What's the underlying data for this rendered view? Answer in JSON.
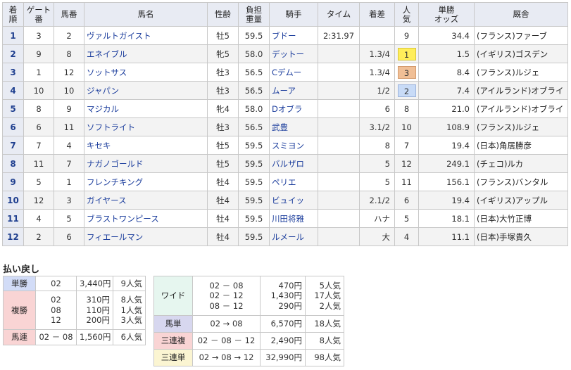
{
  "headers": {
    "rank": [
      "着",
      "順"
    ],
    "gate": [
      "ゲート",
      "番"
    ],
    "number": "馬番",
    "horse": "馬名",
    "sexage": "性齢",
    "weight": [
      "負担",
      "重量"
    ],
    "jockey": "騎手",
    "time": "タイム",
    "margin": "着差",
    "popularity": [
      "人",
      "気"
    ],
    "odds": [
      "単勝",
      "オッズ"
    ],
    "trainer": "厩舎"
  },
  "rows": [
    {
      "rank": "1",
      "gate": "3",
      "number": "2",
      "horse": "ヴァルトガイスト",
      "sexage": "牡5",
      "weight": "59.5",
      "jockey": "ブドー",
      "time": "2:31.97",
      "margin": "",
      "popularity": "9",
      "odds": "34.4",
      "trainer": "(フランス)ファーブ"
    },
    {
      "rank": "2",
      "gate": "9",
      "number": "8",
      "horse": "エネイブル",
      "sexage": "牝5",
      "weight": "58.0",
      "jockey": "デットー",
      "time": "",
      "margin": "1.3/4",
      "popularity": "1",
      "odds": "1.5",
      "trainer": "(イギリス)ゴスデン"
    },
    {
      "rank": "3",
      "gate": "1",
      "number": "12",
      "horse": "ソットサス",
      "sexage": "牡3",
      "weight": "56.5",
      "jockey": "Cデムー",
      "time": "",
      "margin": "1.3/4",
      "popularity": "3",
      "odds": "8.4",
      "trainer": "(フランス)ルジェ"
    },
    {
      "rank": "4",
      "gate": "10",
      "number": "10",
      "horse": "ジャパン",
      "sexage": "牡3",
      "weight": "56.5",
      "jockey": "ムーア",
      "time": "",
      "margin": "1/2",
      "popularity": "2",
      "odds": "7.4",
      "trainer": "(アイルランド)オブライ"
    },
    {
      "rank": "5",
      "gate": "8",
      "number": "9",
      "horse": "マジカル",
      "sexage": "牝4",
      "weight": "58.0",
      "jockey": "Dオブラ",
      "time": "",
      "margin": "6",
      "popularity": "8",
      "odds": "21.0",
      "trainer": "(アイルランド)オブライ"
    },
    {
      "rank": "6",
      "gate": "6",
      "number": "11",
      "horse": "ソフトライト",
      "sexage": "牡3",
      "weight": "56.5",
      "jockey": "武豊",
      "time": "",
      "margin": "3.1/2",
      "popularity": "10",
      "odds": "108.9",
      "trainer": "(フランス)ルジェ"
    },
    {
      "rank": "7",
      "gate": "7",
      "number": "4",
      "horse": "キセキ",
      "sexage": "牡5",
      "weight": "59.5",
      "jockey": "スミヨン",
      "time": "",
      "margin": "8",
      "popularity": "7",
      "odds": "19.4",
      "trainer": "(日本)角居勝彦"
    },
    {
      "rank": "8",
      "gate": "11",
      "number": "7",
      "horse": "ナガノゴールド",
      "sexage": "牡5",
      "weight": "59.5",
      "jockey": "バルザロ",
      "time": "",
      "margin": "5",
      "popularity": "12",
      "odds": "249.1",
      "trainer": "(チェコ)ルカ"
    },
    {
      "rank": "9",
      "gate": "5",
      "number": "1",
      "horse": "フレンチキング",
      "sexage": "牡4",
      "weight": "59.5",
      "jockey": "ペリエ",
      "time": "",
      "margin": "5",
      "popularity": "11",
      "odds": "156.1",
      "trainer": "(フランス)バンタル"
    },
    {
      "rank": "10",
      "gate": "12",
      "number": "3",
      "horse": "ガイヤース",
      "sexage": "牡4",
      "weight": "59.5",
      "jockey": "ビュイッ",
      "time": "",
      "margin": "2.1/2",
      "popularity": "6",
      "odds": "19.4",
      "trainer": "(イギリス)アップル"
    },
    {
      "rank": "11",
      "gate": "4",
      "number": "5",
      "horse": "ブラストワンピース",
      "sexage": "牡4",
      "weight": "59.5",
      "jockey": "川田将雅",
      "time": "",
      "margin": "ハナ",
      "popularity": "5",
      "odds": "18.1",
      "trainer": "(日本)大竹正博"
    },
    {
      "rank": "12",
      "gate": "2",
      "number": "6",
      "horse": "フィエールマン",
      "sexage": "牡4",
      "weight": "59.5",
      "jockey": "ルメール",
      "time": "",
      "margin": "大",
      "popularity": "4",
      "odds": "11.1",
      "trainer": "(日本)手塚貴久"
    }
  ],
  "payout": {
    "title": "払い戻し",
    "tansho": {
      "label": "単勝",
      "combo": "02",
      "amount": "3,440円",
      "pop": "9人気"
    },
    "fukusho": {
      "label": "複勝",
      "items": [
        {
          "combo": "02",
          "amount": "310円",
          "pop": "8人気"
        },
        {
          "combo": "08",
          "amount": "110円",
          "pop": "1人気"
        },
        {
          "combo": "12",
          "amount": "200円",
          "pop": "3人気"
        }
      ]
    },
    "umaren": {
      "label": "馬連",
      "combo": "02 － 08",
      "amount": "1,560円",
      "pop": "6人気"
    },
    "wide": {
      "label": "ワイド",
      "items": [
        {
          "combo": "02 － 08",
          "amount": "470円",
          "pop": "5人気"
        },
        {
          "combo": "02 － 12",
          "amount": "1,430円",
          "pop": "17人気"
        },
        {
          "combo": "08 － 12",
          "amount": "290円",
          "pop": "2人気"
        }
      ]
    },
    "umatan": {
      "label": "馬単",
      "combo": "02 → 08",
      "amount": "6,570円",
      "pop": "18人気"
    },
    "sanrenpuku": {
      "label": "三連複",
      "combo": "02 － 08 － 12",
      "amount": "2,490円",
      "pop": "8人気"
    },
    "sanrentan": {
      "label": "三連単",
      "combo": "02 → 08 → 12",
      "amount": "32,990円",
      "pop": "98人気"
    }
  }
}
